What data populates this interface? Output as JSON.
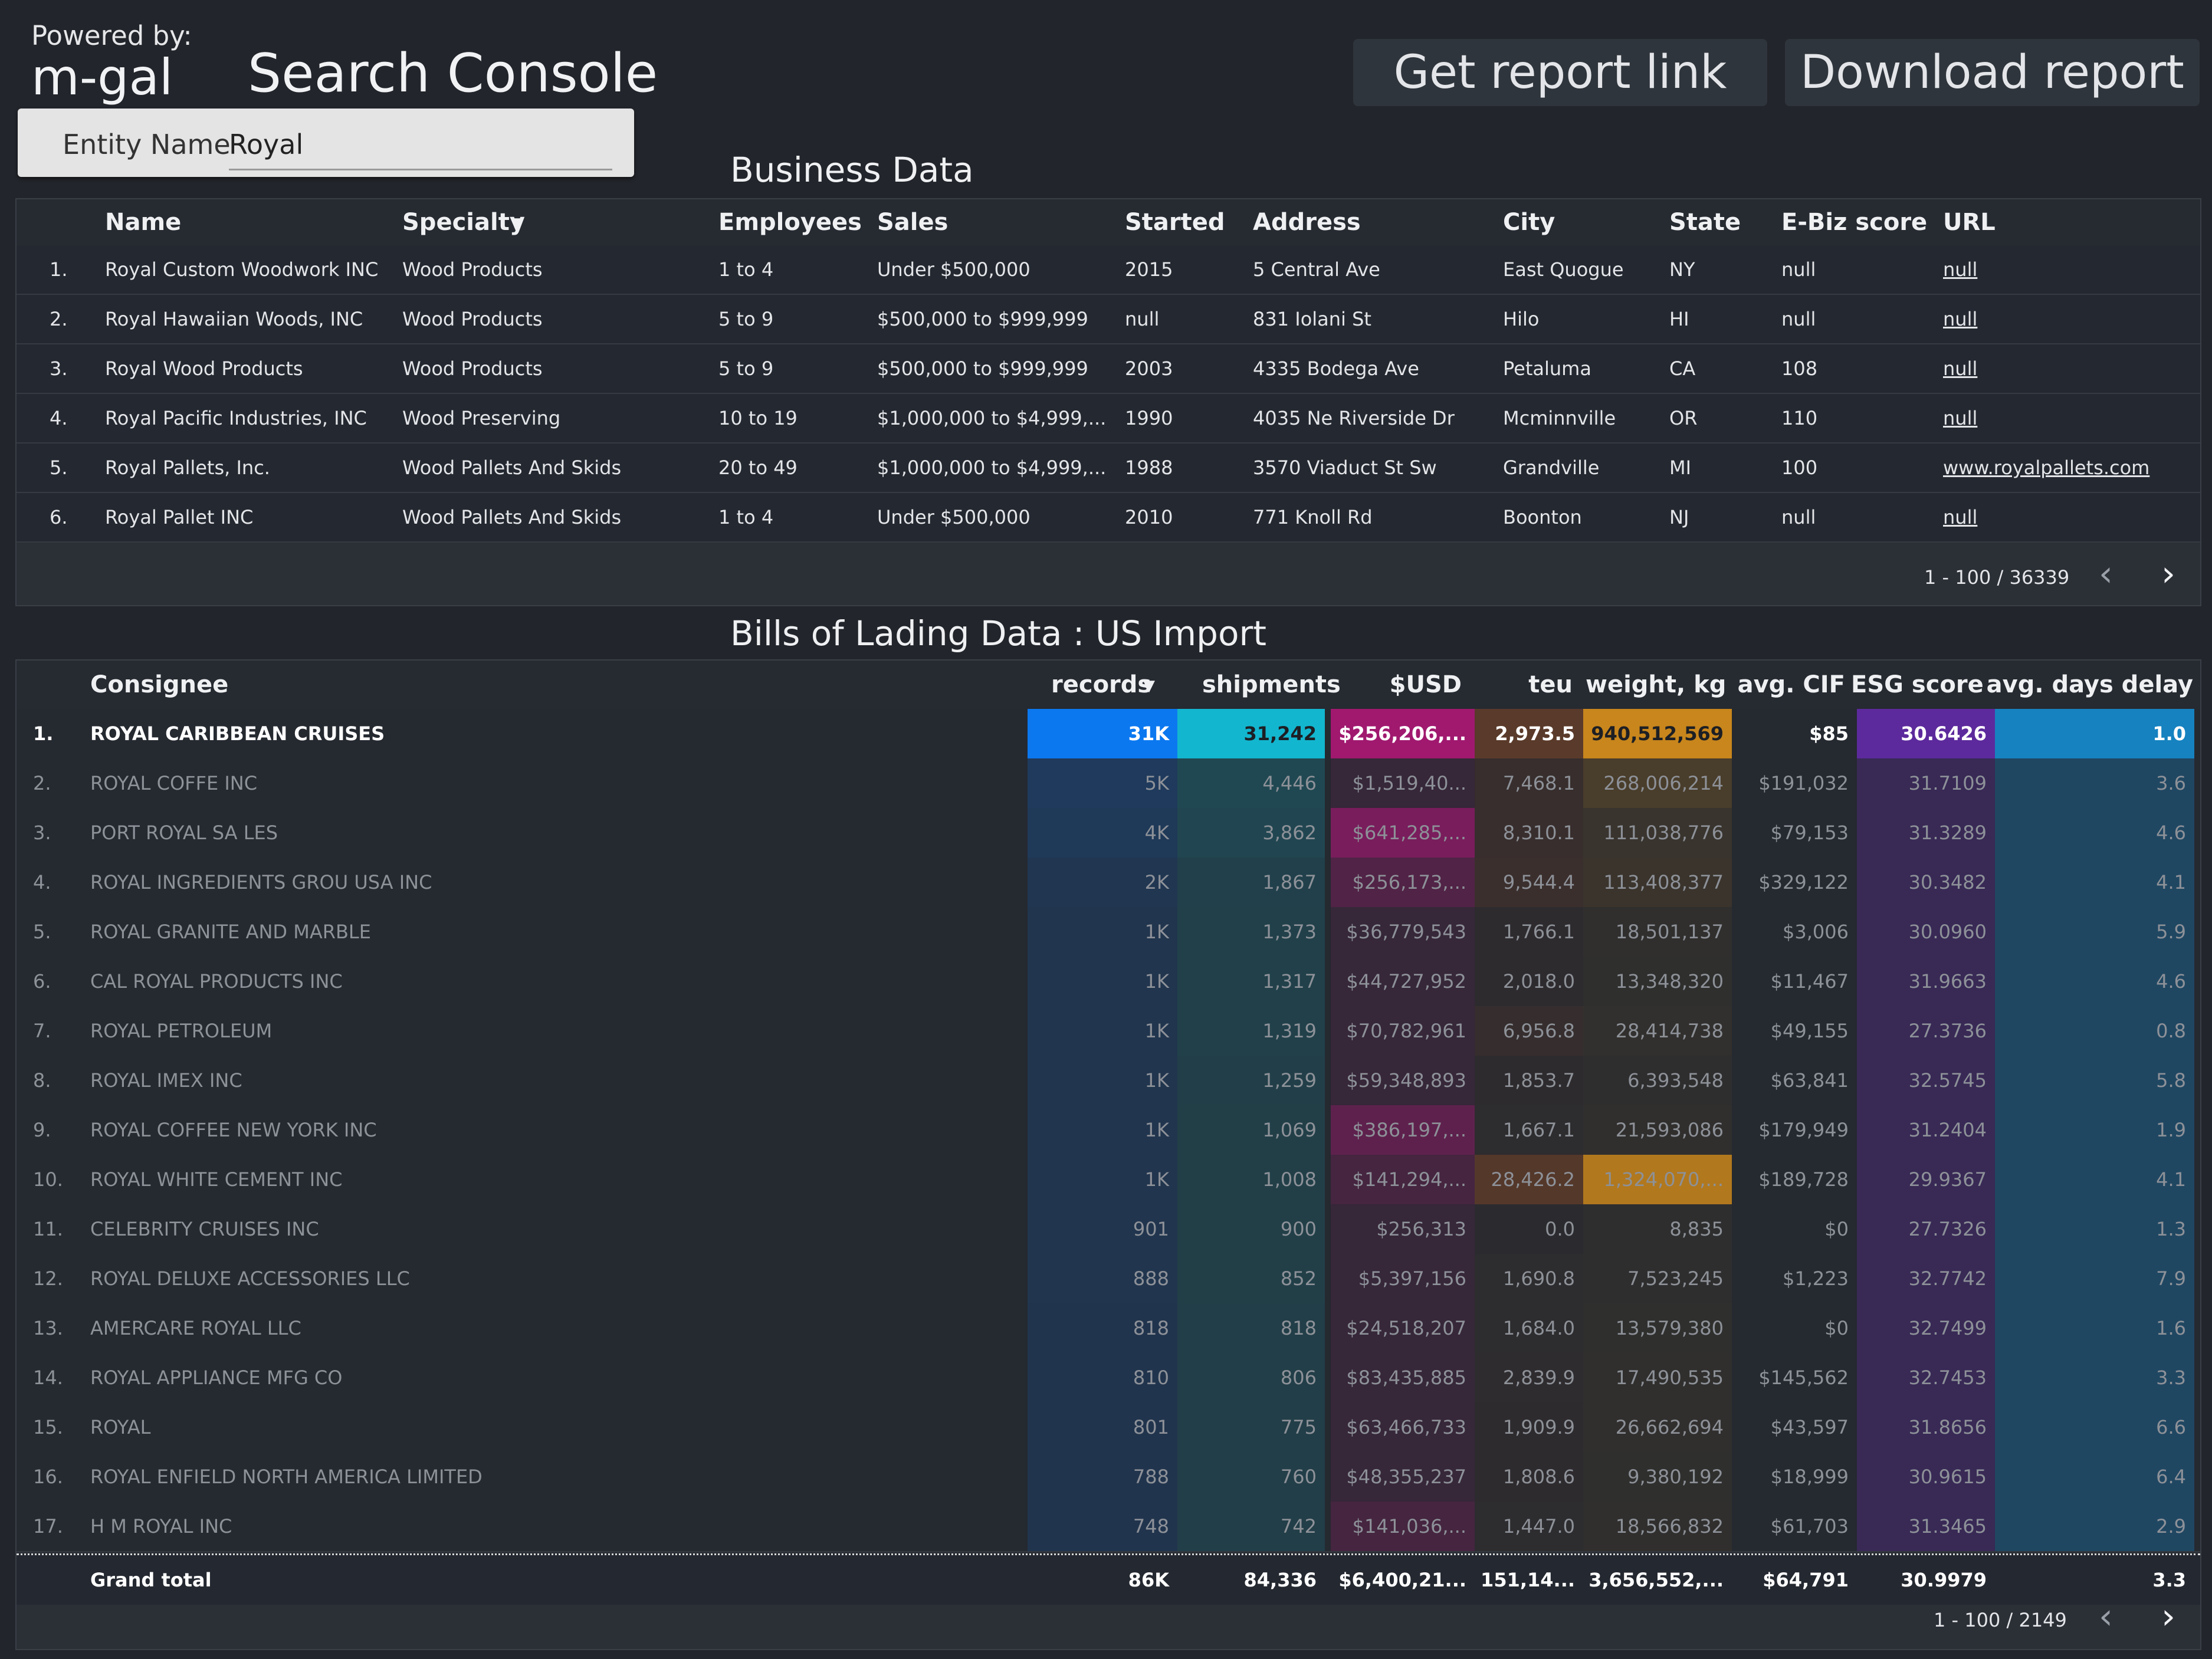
{
  "header": {
    "powered_by": "Powered by:",
    "brand": "m-gal",
    "title": "Search Console",
    "get_report_link": "Get report link",
    "download_report": "Download report"
  },
  "filter": {
    "label": "Entity Name",
    "value": "Royal"
  },
  "business": {
    "title": "Business Data",
    "columns": [
      "Name",
      "Specialty",
      "Employees",
      "Sales",
      "Started",
      "Address",
      "City",
      "State",
      "E-Biz score",
      "URL"
    ],
    "sort_icon": "sort-down-icon",
    "rows": [
      {
        "n": "1.",
        "name": "Royal Custom Woodwork INC",
        "specialty": "Wood Products",
        "employees": "1 to 4",
        "sales": "Under $500,000",
        "started": "2015",
        "address": "5 Central Ave",
        "city": "East Quogue",
        "state": "NY",
        "ebiz": "null",
        "url": "null"
      },
      {
        "n": "2.",
        "name": "Royal Hawaiian Woods, INC",
        "specialty": "Wood Products",
        "employees": "5 to 9",
        "sales": "$500,000 to $999,999",
        "started": "null",
        "address": "831 Iolani St",
        "city": "Hilo",
        "state": "HI",
        "ebiz": "null",
        "url": "null"
      },
      {
        "n": "3.",
        "name": "Royal Wood Products",
        "specialty": "Wood Products",
        "employees": "5 to 9",
        "sales": "$500,000 to $999,999",
        "started": "2003",
        "address": "4335 Bodega Ave",
        "city": "Petaluma",
        "state": "CA",
        "ebiz": "108",
        "url": "null"
      },
      {
        "n": "4.",
        "name": "Royal Pacific Industries, INC",
        "specialty": "Wood Preserving",
        "employees": "10 to 19",
        "sales": "$1,000,000 to $4,999,...",
        "started": "1990",
        "address": "4035 Ne Riverside Dr",
        "city": "Mcminnville",
        "state": "OR",
        "ebiz": "110",
        "url": "null"
      },
      {
        "n": "5.",
        "name": "Royal Pallets, Inc.",
        "specialty": "Wood Pallets And Skids",
        "employees": "20 to 49",
        "sales": "$1,000,000 to $4,999,...",
        "started": "1988",
        "address": "3570 Viaduct St Sw",
        "city": "Grandville",
        "state": "MI",
        "ebiz": "100",
        "url": "www.royalpallets.com"
      },
      {
        "n": "6.",
        "name": "Royal Pallet INC",
        "specialty": "Wood Pallets And Skids",
        "employees": "1 to 4",
        "sales": "Under $500,000",
        "started": "2010",
        "address": "771 Knoll Rd",
        "city": "Boonton",
        "state": "NJ",
        "ebiz": "null",
        "url": "null"
      }
    ],
    "pager": "1 - 100 / 36339"
  },
  "bol": {
    "title": "Bills of Lading Data : US Import",
    "columns": [
      "Consignee",
      "records",
      "shipments",
      "$USD",
      "teu",
      "weight, kg",
      "avg. CIF",
      "ESG score",
      "avg. days delay"
    ],
    "rows": [
      {
        "n": "1.",
        "consignee": "ROYAL CARIBBEAN CRUISES",
        "records": "31K",
        "shipments": "31,242",
        "usd": "$256,206,...",
        "teu": "2,973.5",
        "weight": "940,512,569",
        "cif": "$85",
        "esg": "30.6426",
        "delay": "1.0"
      },
      {
        "n": "2.",
        "consignee": "ROYAL COFFE INC",
        "records": "5K",
        "shipments": "4,446",
        "usd": "$1,519,40...",
        "teu": "7,468.1",
        "weight": "268,006,214",
        "cif": "$191,032",
        "esg": "31.7109",
        "delay": "3.6"
      },
      {
        "n": "3.",
        "consignee": "PORT ROYAL SA LES",
        "records": "4K",
        "shipments": "3,862",
        "usd": "$641,285,...",
        "teu": "8,310.1",
        "weight": "111,038,776",
        "cif": "$79,153",
        "esg": "31.3289",
        "delay": "4.6"
      },
      {
        "n": "4.",
        "consignee": "ROYAL INGREDIENTS GROU USA INC",
        "records": "2K",
        "shipments": "1,867",
        "usd": "$256,173,...",
        "teu": "9,544.4",
        "weight": "113,408,377",
        "cif": "$329,122",
        "esg": "30.3482",
        "delay": "4.1"
      },
      {
        "n": "5.",
        "consignee": "ROYAL GRANITE AND MARBLE",
        "records": "1K",
        "shipments": "1,373",
        "usd": "$36,779,543",
        "teu": "1,766.1",
        "weight": "18,501,137",
        "cif": "$3,006",
        "esg": "30.0960",
        "delay": "5.9"
      },
      {
        "n": "6.",
        "consignee": "CAL ROYAL PRODUCTS INC",
        "records": "1K",
        "shipments": "1,317",
        "usd": "$44,727,952",
        "teu": "2,018.0",
        "weight": "13,348,320",
        "cif": "$11,467",
        "esg": "31.9663",
        "delay": "4.6"
      },
      {
        "n": "7.",
        "consignee": "ROYAL PETROLEUM",
        "records": "1K",
        "shipments": "1,319",
        "usd": "$70,782,961",
        "teu": "6,956.8",
        "weight": "28,414,738",
        "cif": "$49,155",
        "esg": "27.3736",
        "delay": "0.8"
      },
      {
        "n": "8.",
        "consignee": "ROYAL IMEX INC",
        "records": "1K",
        "shipments": "1,259",
        "usd": "$59,348,893",
        "teu": "1,853.7",
        "weight": "6,393,548",
        "cif": "$63,841",
        "esg": "32.5745",
        "delay": "5.8"
      },
      {
        "n": "9.",
        "consignee": "ROYAL COFFEE NEW YORK INC",
        "records": "1K",
        "shipments": "1,069",
        "usd": "$386,197,...",
        "teu": "1,667.1",
        "weight": "21,593,086",
        "cif": "$179,949",
        "esg": "31.2404",
        "delay": "1.9"
      },
      {
        "n": "10.",
        "consignee": "ROYAL WHITE CEMENT INC",
        "records": "1K",
        "shipments": "1,008",
        "usd": "$141,294,...",
        "teu": "28,426.2",
        "weight": "1,324,070,...",
        "cif": "$189,728",
        "esg": "29.9367",
        "delay": "4.1"
      },
      {
        "n": "11.",
        "consignee": "CELEBRITY CRUISES INC",
        "records": "901",
        "shipments": "900",
        "usd": "$256,313",
        "teu": "0.0",
        "weight": "8,835",
        "cif": "$0",
        "esg": "27.7326",
        "delay": "1.3"
      },
      {
        "n": "12.",
        "consignee": "ROYAL DELUXE ACCESSORIES LLC",
        "records": "888",
        "shipments": "852",
        "usd": "$5,397,156",
        "teu": "1,690.8",
        "weight": "7,523,245",
        "cif": "$1,223",
        "esg": "32.7742",
        "delay": "7.9"
      },
      {
        "n": "13.",
        "consignee": "AMERCARE ROYAL LLC",
        "records": "818",
        "shipments": "818",
        "usd": "$24,518,207",
        "teu": "1,684.0",
        "weight": "13,579,380",
        "cif": "$0",
        "esg": "32.7499",
        "delay": "1.6"
      },
      {
        "n": "14.",
        "consignee": "ROYAL APPLIANCE MFG CO",
        "records": "810",
        "shipments": "806",
        "usd": "$83,435,885",
        "teu": "2,839.9",
        "weight": "17,490,535",
        "cif": "$145,562",
        "esg": "32.7453",
        "delay": "3.3"
      },
      {
        "n": "15.",
        "consignee": "ROYAL",
        "records": "801",
        "shipments": "775",
        "usd": "$63,466,733",
        "teu": "1,909.9",
        "weight": "26,662,694",
        "cif": "$43,597",
        "esg": "31.8656",
        "delay": "6.6"
      },
      {
        "n": "16.",
        "consignee": "ROYAL ENFIELD NORTH AMERICA LIMITED",
        "records": "788",
        "shipments": "760",
        "usd": "$48,355,237",
        "teu": "1,808.6",
        "weight": "9,380,192",
        "cif": "$18,999",
        "esg": "30.9615",
        "delay": "6.4"
      },
      {
        "n": "17.",
        "consignee": "H M ROYAL INC",
        "records": "748",
        "shipments": "742",
        "usd": "$141,036,...",
        "teu": "1,447.0",
        "weight": "18,566,832",
        "cif": "$61,703",
        "esg": "31.3465",
        "delay": "2.9"
      }
    ],
    "total": {
      "label": "Grand total",
      "records": "86K",
      "shipments": "84,336",
      "usd": "$6,400,21...",
      "teu": "151,14...",
      "weight": "3,656,552,...",
      "cif": "$64,791",
      "esg": "30.9979",
      "delay": "3.3"
    },
    "pager": "1 - 100 / 2149",
    "colors": {
      "records": "#0b78f0",
      "shipments": "#13b6cf",
      "usd": "#a0196f",
      "teu": "#5a3a2a",
      "weight": "#c8861c",
      "esg": "#5c2a9c",
      "delay": "#1682c0"
    }
  }
}
